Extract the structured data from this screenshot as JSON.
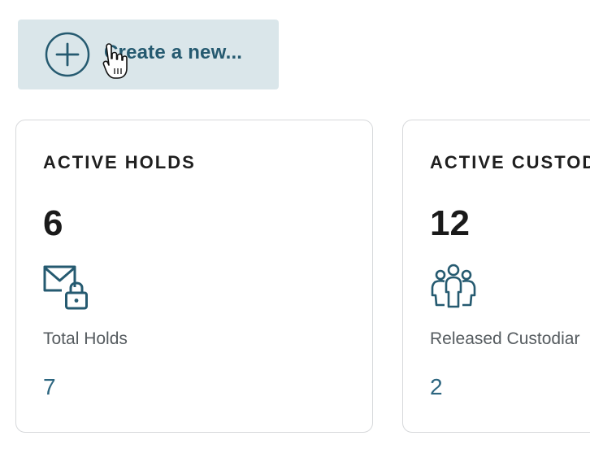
{
  "create_button": {
    "label": "Create a new...",
    "icon": "plus-circle-icon"
  },
  "cards": [
    {
      "title": "ACTIVE HOLDS",
      "count": "6",
      "icon": "mail-lock-icon",
      "sub_label": "Total Holds",
      "sub_value": "7"
    },
    {
      "title": "ACTIVE CUSTODI",
      "count": "12",
      "icon": "people-group-icon",
      "sub_label": "Released Custodiar",
      "sub_value": "2"
    }
  ],
  "colors": {
    "accent": "#255a70",
    "button_bg": "#dae6ea",
    "card_border": "#d7d9db",
    "link_value": "#2d6680"
  }
}
